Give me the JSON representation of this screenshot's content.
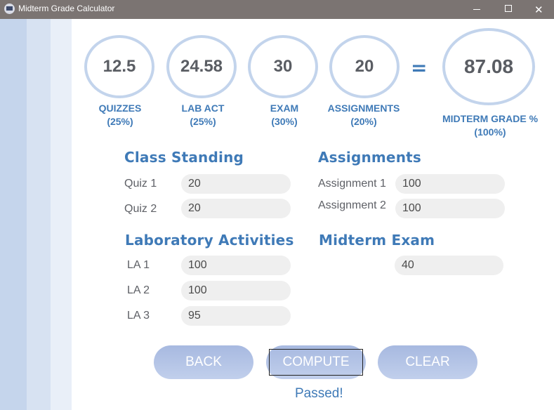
{
  "window": {
    "title": "Midterm Grade Calculator"
  },
  "summary": {
    "components": [
      {
        "value": "12.5",
        "label": "QUIZZES",
        "weight": "(25%)"
      },
      {
        "value": "24.58",
        "label": "LAB ACT",
        "weight": "(25%)"
      },
      {
        "value": "30",
        "label": "EXAM",
        "weight": "(30%)"
      },
      {
        "value": "20",
        "label": "ASSIGNMENTS",
        "weight": "(20%)"
      }
    ],
    "equals": "=",
    "total": {
      "value": "87.08",
      "label": "MIDTERM GRADE %",
      "weight": "(100%)"
    }
  },
  "class_standing": {
    "title": "Class Standing",
    "fields": [
      {
        "label": "Quiz 1",
        "value": "20"
      },
      {
        "label": "Quiz 2",
        "value": "20"
      }
    ]
  },
  "assignments": {
    "title": "Assignments",
    "fields": [
      {
        "label": "Assignment 1",
        "value": "100"
      },
      {
        "label": "Assignment 2",
        "value": "100"
      }
    ]
  },
  "lab_activities": {
    "title": "Laboratory Activities",
    "fields": [
      {
        "label": "LA 1",
        "value": "100"
      },
      {
        "label": "LA 2",
        "value": "100"
      },
      {
        "label": "LA 3",
        "value": "95"
      }
    ]
  },
  "midterm_exam": {
    "title": "Midterm Exam",
    "value": "40"
  },
  "buttons": {
    "back": "BACK",
    "compute": "COMPUTE",
    "clear": "CLEAR"
  },
  "status": "Passed!",
  "colors": {
    "accent": "#3f7ab7",
    "titlebar": "#7b7472",
    "circle_border": "#c3d4ec",
    "button": "#b3c4e6",
    "field": "#efefef"
  }
}
